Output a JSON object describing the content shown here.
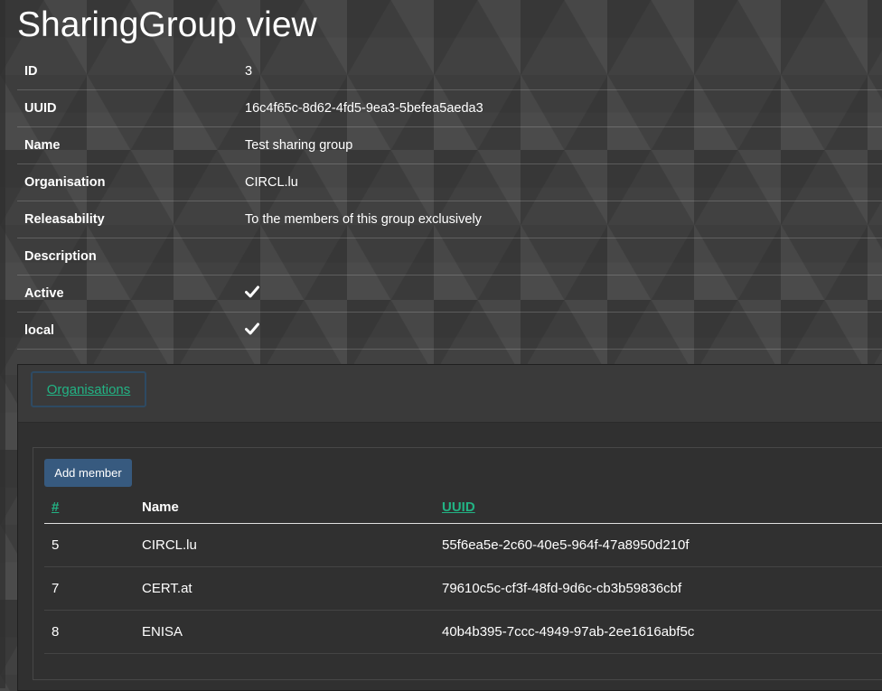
{
  "page": {
    "title": "SharingGroup view"
  },
  "details": [
    {
      "key": "ID",
      "value": "3"
    },
    {
      "key": "UUID",
      "value": "16c4f65c-8d62-4fd5-9ea3-5befea5aeda3"
    },
    {
      "key": "Name",
      "value": "Test sharing group"
    },
    {
      "key": "Organisation",
      "value": "CIRCL.lu"
    },
    {
      "key": "Releasability",
      "value": "To the members of this group exclusively"
    },
    {
      "key": "Description",
      "value": ""
    },
    {
      "key": "Active",
      "value": "",
      "icon": "check-icon"
    },
    {
      "key": "local",
      "value": "",
      "icon": "check-icon"
    }
  ],
  "tabs": [
    {
      "label": "Organisations"
    }
  ],
  "members": {
    "add_button_label": "Add member",
    "columns": [
      "#",
      "Name",
      "UUID"
    ],
    "rows": [
      {
        "id": "5",
        "name": "CIRCL.lu",
        "uuid": "55f6ea5e-2c60-40e5-964f-47a8950d210f"
      },
      {
        "id": "7",
        "name": "CERT.at",
        "uuid": "79610c5c-cf3f-48fd-9d6c-cb3b59836cbf"
      },
      {
        "id": "8",
        "name": "ENISA",
        "uuid": "40b4b395-7ccc-4949-97ab-2ee1616abf5c"
      }
    ]
  },
  "colors": {
    "link": "#22b384",
    "button": "#375a7f",
    "panel": "#303030"
  }
}
